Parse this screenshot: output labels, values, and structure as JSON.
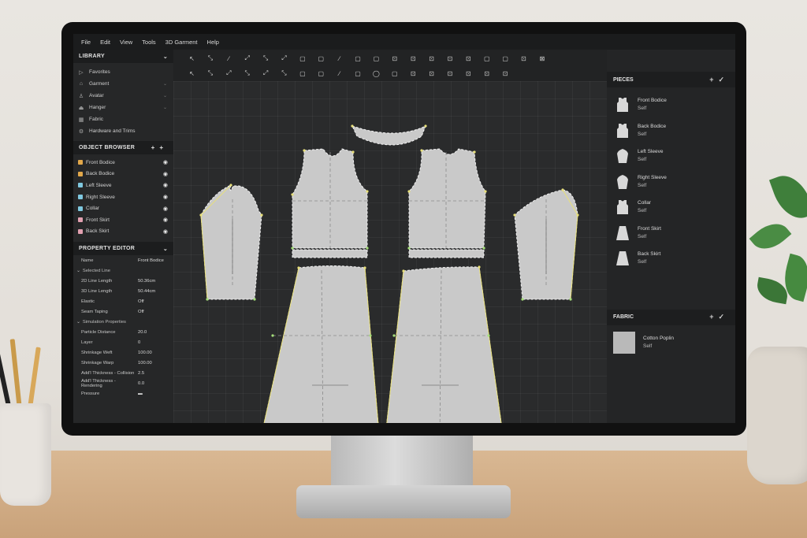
{
  "menu": [
    "File",
    "Edit",
    "View",
    "Tools",
    "3D Garment",
    "Help"
  ],
  "library": {
    "title": "LIBRARY",
    "items": [
      {
        "label": "Favorites",
        "icon": "favorites-icon",
        "glyph": "▷"
      },
      {
        "label": "Garment",
        "icon": "garment-icon",
        "glyph": "⌂"
      },
      {
        "label": "Avatar",
        "icon": "avatar-icon",
        "glyph": "♙"
      },
      {
        "label": "Hanger",
        "icon": "hanger-icon",
        "glyph": "⏏"
      },
      {
        "label": "Fabric",
        "icon": "fabric-icon",
        "glyph": "▦"
      },
      {
        "label": "Hardware and Trims",
        "icon": "trims-icon",
        "glyph": "⚙"
      }
    ]
  },
  "object_browser": {
    "title": "OBJECT BROWSER",
    "items": [
      {
        "label": "Front Bodice",
        "color": "#e2a84a"
      },
      {
        "label": "Back Bodice",
        "color": "#e2a84a"
      },
      {
        "label": "Left Sleeve",
        "color": "#7fc8df"
      },
      {
        "label": "Right Sleeve",
        "color": "#7fc8df"
      },
      {
        "label": "Collar",
        "color": "#7fc8df"
      },
      {
        "label": "Front Skirt",
        "color": "#e2a0b0"
      },
      {
        "label": "Back Skirt",
        "color": "#e2a0b0"
      }
    ]
  },
  "property_editor": {
    "title": "PROPERTY EDITOR",
    "name_label": "Name",
    "name_value": "Front Bodice",
    "selected_line_label": "Selected Line",
    "line_rows": [
      {
        "k": "2D Line Length",
        "v": "50.36cm"
      },
      {
        "k": "3D Line Length",
        "v": "50.44cm"
      },
      {
        "k": "Elastic",
        "v": "Off"
      },
      {
        "k": "Seam Taping",
        "v": "Off"
      }
    ],
    "sim_label": "Simulation Properties",
    "sim_rows": [
      {
        "k": "Particle Distance",
        "v": "20.0"
      },
      {
        "k": "Layer",
        "v": "0"
      },
      {
        "k": "Shrinkage Weft",
        "v": "100.00"
      },
      {
        "k": "Shrinkage Warp",
        "v": "100.00"
      },
      {
        "k": "Add'l Thickness - Collision",
        "v": "2.5"
      },
      {
        "k": "Add'l Thickness - Rendering",
        "v": "0.0"
      },
      {
        "k": "Pressure",
        "v": "▬"
      }
    ]
  },
  "toolbar": {
    "row1": [
      "↖",
      "⤡",
      "∕",
      "⤢",
      "⤡",
      "⤢",
      "▢",
      "▢",
      "∕",
      "▢",
      "▢",
      "⊡",
      "⊡",
      "⊡",
      "⊡",
      "⊡",
      "▢",
      "▢",
      "⊡",
      "⊠"
    ],
    "row2": [
      "↖",
      "⤡",
      "⤢",
      "⤡",
      "⤢",
      "⤡",
      "▢",
      "▢",
      "∕",
      "▢",
      "◯",
      "▢",
      "⊡",
      "⊡",
      "⊡",
      "⊡",
      "⊡",
      "⊡"
    ]
  },
  "pieces": {
    "title": "PIECES",
    "add": "+",
    "confirm": "✓",
    "items": [
      {
        "name": "Front Bodice",
        "material": "Self",
        "icon": "bodice-icon"
      },
      {
        "name": "Back Bodice",
        "material": "Self",
        "icon": "bodice-icon"
      },
      {
        "name": "Left Sleeve",
        "material": "Self",
        "icon": "sleeve-icon"
      },
      {
        "name": "Right Sleeve",
        "material": "Self",
        "icon": "sleeve-icon"
      },
      {
        "name": "Collar",
        "material": "Self",
        "icon": "bodice-icon"
      },
      {
        "name": "Front Skirt",
        "material": "Self",
        "icon": "skirt-icon"
      },
      {
        "name": "Back Skirt",
        "material": "Self",
        "icon": "skirt-icon"
      }
    ]
  },
  "fabric": {
    "title": "FABRIC",
    "add": "+",
    "confirm": "✓",
    "name": "Cotton Poplin",
    "material": "Self",
    "swatch_color": "#b9b9b9"
  },
  "colors": {
    "piece_fill": "#c8c8c8",
    "seam_yellow": "#e8e07a",
    "point_green": "#a6e07a"
  }
}
